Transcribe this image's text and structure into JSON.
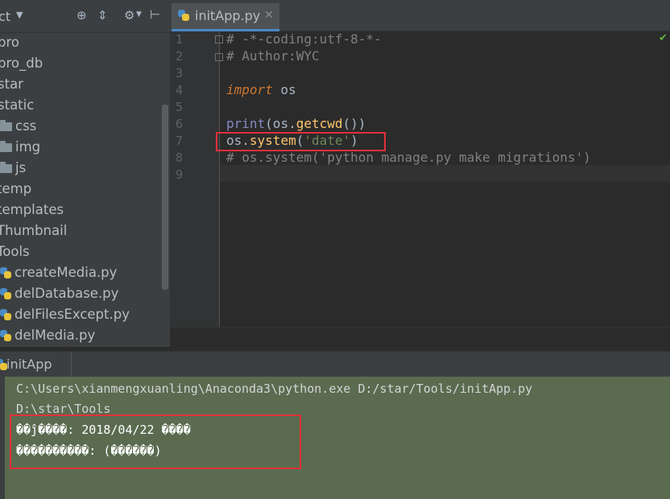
{
  "project_panel": {
    "title_fragment": "ct",
    "items": [
      {
        "label": "pro",
        "type": "folder-cut"
      },
      {
        "label": "pro_db",
        "type": "folder-cut"
      },
      {
        "label": "star",
        "type": "folder-cut"
      },
      {
        "label": "static",
        "type": "folder-cut"
      },
      {
        "label": "css",
        "type": "folder"
      },
      {
        "label": "img",
        "type": "folder"
      },
      {
        "label": "js",
        "type": "folder"
      },
      {
        "label": "temp",
        "type": "folder-cut"
      },
      {
        "label": "templates",
        "type": "folder-cut"
      },
      {
        "label": "Thumbnail",
        "type": "folder-cut"
      },
      {
        "label": "Tools",
        "type": "folder-cut"
      },
      {
        "label": "createMedia.py",
        "type": "python"
      },
      {
        "label": "delDatabase.py",
        "type": "python"
      },
      {
        "label": "delFilesExcept.py",
        "type": "python"
      },
      {
        "label": "delMedia.py",
        "type": "python"
      }
    ]
  },
  "editor": {
    "tab_label": "initApp.py",
    "line_numbers": [
      "1",
      "2",
      "3",
      "4",
      "5",
      "6",
      "7",
      "8",
      "9"
    ],
    "lines": {
      "l1": "# -*-coding:utf-8-*-",
      "l2": "# Author:WYC",
      "l4_kw": "import",
      "l4_rest": " os",
      "l6_print": "print",
      "l6_a": "(os.",
      "l6_fn": "getcwd",
      "l6_b": "())",
      "l7_a": "os.",
      "l7_fn": "system",
      "l7_b": "(",
      "l7_str": "'date'",
      "l7_c": ")",
      "l8": "# os.system('python manage.py make migrations')"
    }
  },
  "run_panel": {
    "title": "initApp",
    "output": [
      "C:\\Users\\xianmengxuanling\\Anaconda3\\python.exe D:/star/Tools/initApp.py",
      "D:\\star\\Tools",
      "��ĵ����: 2018/04/22 ����",
      "����������: (������)"
    ]
  },
  "colors": {
    "accent": "#4a88c7",
    "highlight_box": "#e2303a",
    "console_bg": "#5a6b50"
  }
}
